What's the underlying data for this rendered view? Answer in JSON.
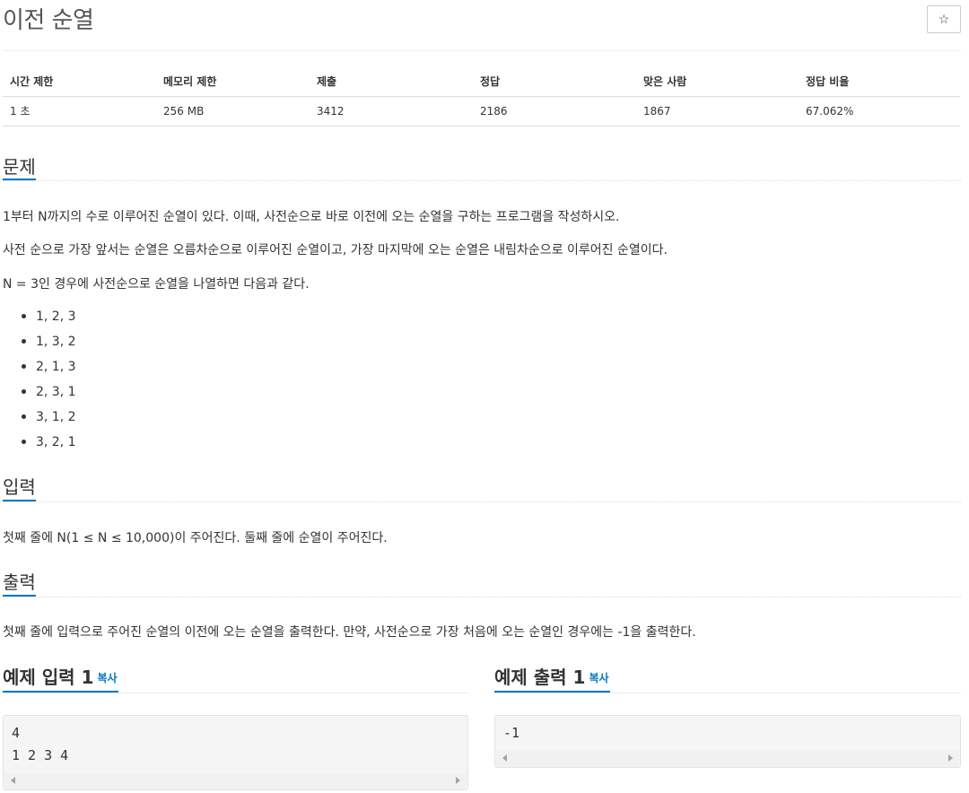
{
  "problem": {
    "title": "이전 순열",
    "star_icon": "☆"
  },
  "info_table": {
    "headers": [
      "시간 제한",
      "메모리 제한",
      "제출",
      "정답",
      "맞은 사람",
      "정답 비율"
    ],
    "values": [
      "1 초",
      "256 MB",
      "3412",
      "2186",
      "1867",
      "67.062%"
    ]
  },
  "description": {
    "heading": "문제",
    "paragraphs": [
      "1부터 N까지의 수로 이루어진 순열이 있다. 이때, 사전순으로 바로 이전에 오는 순열을 구하는 프로그램을 작성하시오.",
      "사전 순으로 가장 앞서는 순열은 오름차순으로 이루어진 순열이고, 가장 마지막에 오는 순열은 내림차순으로 이루어진 순열이다.",
      "N = 3인 경우에 사전순으로 순열을 나열하면 다음과 같다."
    ],
    "list": [
      "1, 2, 3",
      "1, 3, 2",
      "2, 1, 3",
      "2, 3, 1",
      "3, 1, 2",
      "3, 2, 1"
    ]
  },
  "input": {
    "heading": "입력",
    "text": "첫째 줄에 N(1 ≤ N ≤ 10,000)이 주어진다. 둘째 줄에 순열이 주어진다."
  },
  "output": {
    "heading": "출력",
    "text": "첫째 줄에 입력으로 주어진 순열의 이전에 오는 순열을 출력한다. 만약, 사전순으로 가장 처음에 오는 순열인 경우에는 -1을 출력한다."
  },
  "sample_input": {
    "heading": "예제 입력 1",
    "copy_label": "복사",
    "lines": [
      "4",
      "1 2 3 4"
    ]
  },
  "sample_output": {
    "heading": "예제 출력 1",
    "copy_label": "복사",
    "lines": [
      "-1"
    ]
  },
  "colors": {
    "accent": "#0076c0",
    "code_bg": "#f5f5f5"
  }
}
